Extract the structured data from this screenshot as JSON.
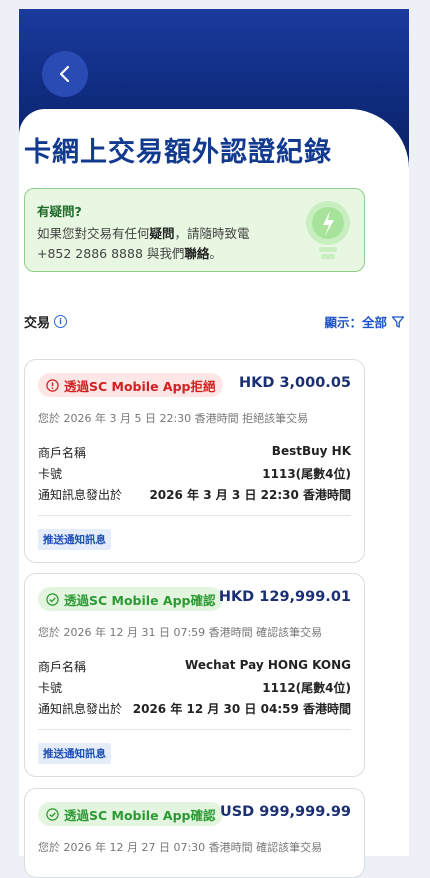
{
  "page": {
    "title": "卡網上交易額外認證紀錄"
  },
  "help": {
    "title": "有疑問?",
    "line1_a": "如果您對交易有任何",
    "line1_b": "疑問",
    "line1_c": "，請隨時致電",
    "line2_a": "+852 2886 8888 與我們",
    "line2_b": "聯絡",
    "line2_c": "。"
  },
  "section": {
    "label": "交易",
    "filter_label": "顯示：全部"
  },
  "cards": [
    {
      "status": "透過SC Mobile App拒絕",
      "status_type": "reject",
      "amount": "HKD 3,000.05",
      "note": "您於 2026 年 3 月 5 日 22:30 香港時間 拒絕該筆交易",
      "merchant_label": "商戶名稱",
      "merchant": "BestBuy HK",
      "card_label": "卡號",
      "card": "1113(尾數4位)",
      "notice_label": "通知訊息發出於",
      "notice": "2026 年 3 月 3 日 22:30 香港時間",
      "tag": "推送通知訊息"
    },
    {
      "status": "透過SC Mobile App確認",
      "status_type": "confirm",
      "amount": "HKD 129,999.01",
      "note": "您於 2026 年 12 月 31 日 07:59 香港時間 確認該筆交易",
      "merchant_label": "商戶名稱",
      "merchant": "Wechat Pay HONG KONG",
      "card_label": "卡號",
      "card": "1112(尾數4位)",
      "notice_label": "通知訊息發出於",
      "notice": "2026 年 12 月 30 日 04:59 香港時間",
      "tag": "推送通知訊息"
    },
    {
      "status": "透過SC Mobile App確認",
      "status_type": "confirm",
      "amount": "USD 999,999.99",
      "note": "您於 2026 年 12 月 27 日 07:30 香港時間 確認該筆交易"
    }
  ],
  "colors": {
    "header_blue": "#0e2a7c",
    "title_blue": "#123a8f",
    "reject_red": "#d21f1f",
    "confirm_green": "#2a9a32"
  }
}
